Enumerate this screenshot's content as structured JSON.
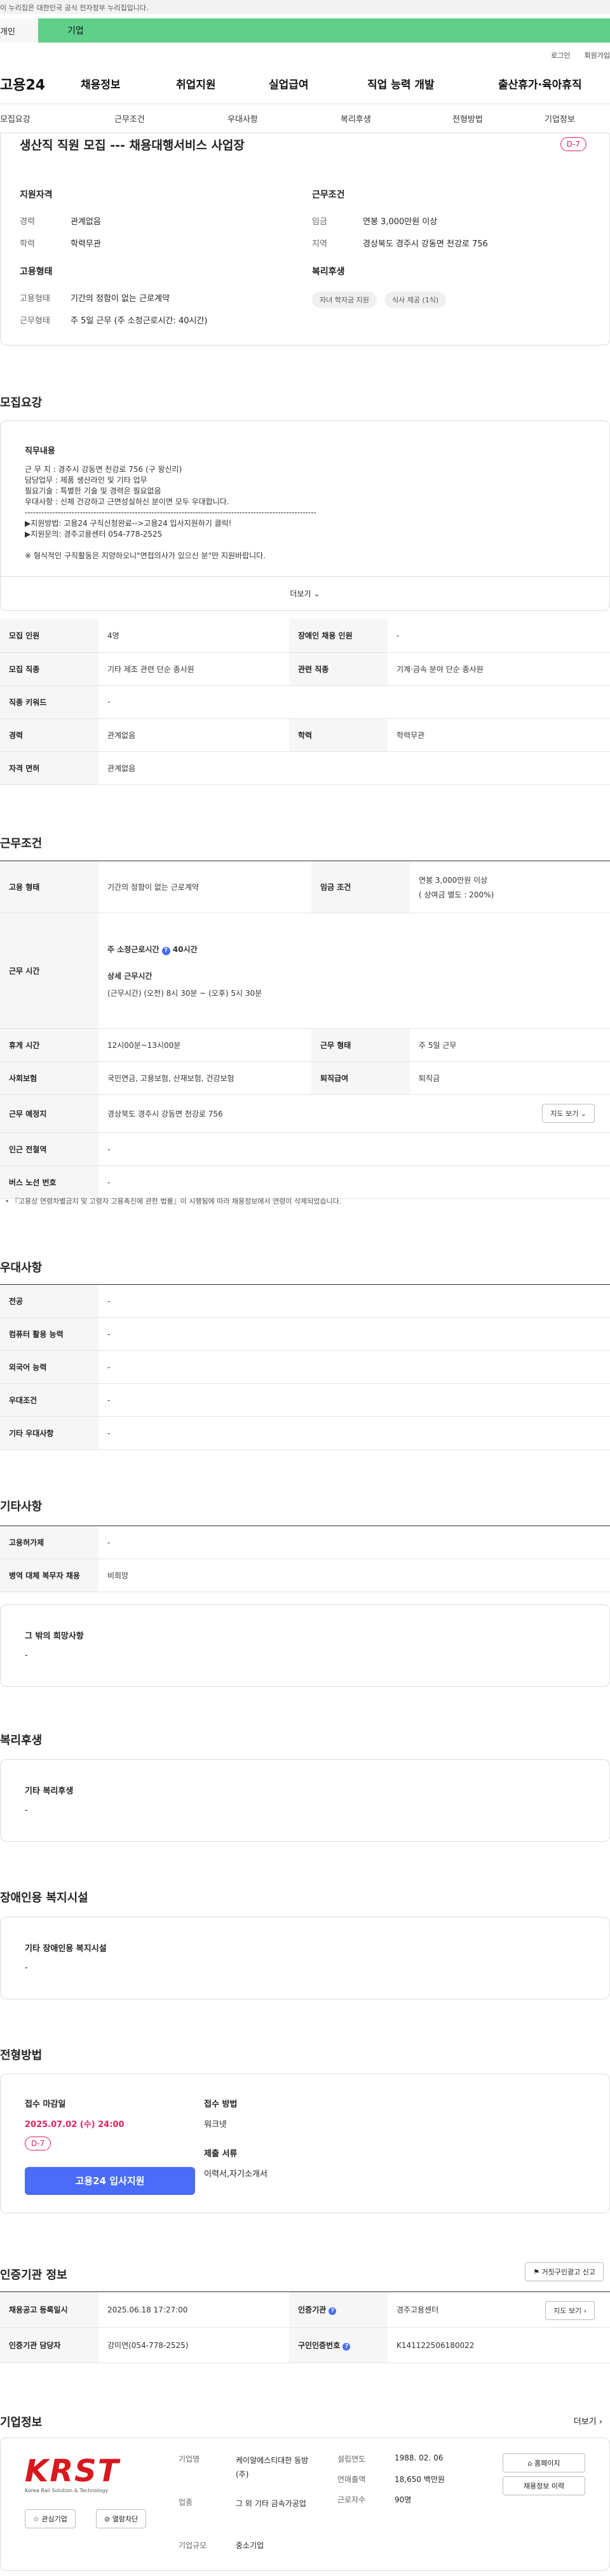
{
  "gov_banner": "이 누리집은 대한민국 공식 전자정부 누리집입니다.",
  "top_left": "개인",
  "top_tab": "기업",
  "util": [
    "로그인",
    "회원가입"
  ],
  "logo": "고용24",
  "gnb": [
    "채용정보",
    "취업지원",
    "실업급여",
    "직업 능력 개발",
    "출산휴가·육아휴직"
  ],
  "tabs": [
    "모집요강",
    "근무조건",
    "우대사항",
    "복리후생",
    "전형방법",
    "기업정보"
  ],
  "job": {
    "title": "생산직 직원 모집 --- 채용대행서비스 사업장",
    "dday": "D-7",
    "qual_title": "지원자격",
    "career_k": "경력",
    "career_v": "관계없음",
    "edu_k": "학력",
    "edu_v": "학력무관",
    "cond_title": "근무조건",
    "wage_k": "임금",
    "wage_v": "연봉 3,000만원 이상",
    "loc_k": "지역",
    "loc_v": "경상북도 경주시 강동면 천강로 756",
    "emp_title": "고용형태",
    "type_k": "고용형태",
    "type_v": "기간의 정함이 없는 근로계약",
    "form_k": "근무형태",
    "form_v": "주 5일 근무 (주 소정근로시간: 40시간)",
    "welfare_title": "복리후생",
    "welfare_chips": [
      "자녀 학자금 지원",
      "식사 제공 (1식)"
    ]
  },
  "recruit": {
    "title": "모집요강",
    "duty_title": "직무내용",
    "duty_lines": [
      "근  무  지 : 경주시 강동면 천강로 756 (구 왕신리)",
      "담당업무 : 제품 생산라인 및 기타 업무",
      "필요기술 : 특별한 기술 및 경력은 필요없음",
      "우대사항 : 신체 건강하고 근면성실하신 분이면 모두 우대합니다.",
      "----------------------------------------------------------------------------------------------------------",
      "▶지원방법: 고용24 구직신청완료-->고용24 입사지원하기 클릭!",
      "▶지원문의: 경주고용센터 054-778-2525",
      "",
      "※ 형식적인 구직활동은 지양하오니\"면접의사가 있으신 분\"만 지원바랍니다."
    ],
    "more": "더보기",
    "rows": [
      [
        "모집 인원",
        "4명",
        "장애인 채용 인원",
        "-"
      ],
      [
        "모집 직종",
        "기타 제조 관련 단순 종사원",
        "관련 직종",
        "기계·금속 분야 단순 종사원"
      ],
      [
        "직종 키워드",
        "-",
        "",
        ""
      ],
      [
        "경력",
        "관계없음",
        "학력",
        "학력무관"
      ],
      [
        "자격 면허",
        "관계없음",
        "",
        ""
      ]
    ]
  },
  "work": {
    "title": "근무조건",
    "emp_k": "고용 형태",
    "emp_v": "기간의 정함이 없는 근로계약",
    "wage_k": "임금 조건",
    "wage_v1": "연봉 3,000만원 이상",
    "wage_v2": "( 상여금 별도 : 200%)",
    "time_k": "근무 시간",
    "time_v1": "주 소정근로시간",
    "time_v1b": "40시간",
    "time_v2": "상세 근무시간",
    "time_v3": "(근무시간) (오전) 8시 30분 ~ (오후) 5시 30분",
    "rest_k": "휴게 시간",
    "rest_v": "12시00분~13시00분",
    "form_k": "근무 형태",
    "form_v": "주 5일 근무",
    "ins_k": "사회보험",
    "ins_v": "국민연금, 고용보험, 산재보험, 건강보험",
    "sev_k": "퇴직급여",
    "sev_v": "퇴직금",
    "place_k": "근무 예정지",
    "place_v": "경상북도 경주시 강동면 천강로 756",
    "map": "지도 보기",
    "sub_k": "인근 전철역",
    "sub_v": "-",
    "bus_k": "버스 노선 번호",
    "bus_v": "-",
    "note": "• 『고용상 연령차별금지 및 고령자 고용촉진에 관한 법률』이 시행됨에 따라 채용정보에서 연령이 삭제되었습니다."
  },
  "pref": {
    "title": "우대사항",
    "rows": [
      [
        "전공",
        "-"
      ],
      [
        "컴퓨터 활용 능력",
        "-"
      ],
      [
        "외국어 능력",
        "-"
      ],
      [
        "우대조건",
        "-"
      ],
      [
        "기타 우대사항",
        "-"
      ]
    ]
  },
  "etc": {
    "title": "기타사항",
    "rows": [
      [
        "고용허가제",
        "-"
      ],
      [
        "병역 대체 복무자 채용",
        "비희망"
      ]
    ],
    "other_title": "그 밖의 희망사항",
    "other_v": "-"
  },
  "welfare": {
    "title": "복리후생",
    "sub": "기타 복리후생",
    "v": "-"
  },
  "disab": {
    "title": "장애인용 복지시설",
    "sub": "기타 장애인용 복지시설",
    "v": "-"
  },
  "process": {
    "title": "전형방법",
    "deadline_k": "접수 마감일",
    "deadline_v": "2025.07.02 (수) 24:00",
    "dday": "D-7",
    "apply_btn": "고용24 입사지원",
    "method_k": "접수 방법",
    "method_v": "워크넷",
    "docs_k": "제출 서류",
    "docs_v": "이력서,자기소개서"
  },
  "cert": {
    "title": "인증기관 정보",
    "report": "거짓구인광고 신고",
    "reg_k": "채용공고 등록일시",
    "reg_v": "2025.06.18 17:27:00",
    "org_k": "인증기관",
    "org_v": "경주고용센터",
    "map": "지도 보기",
    "mgr_k": "인증기관 담당자",
    "mgr_v": "강미연(054-778-2525)",
    "no_k": "구인인증번호",
    "no_v": "K141122506180022"
  },
  "company": {
    "title": "기업정보",
    "more": "더보기",
    "logo_text": "KRST",
    "logo_sub": "Korea Rail Solution & Technology",
    "fav": "관심기업",
    "block": "열람차단",
    "name_k": "기업명",
    "name_v": "케이알에스티대한 동방(주)",
    "ind_k": "업종",
    "ind_v": "그 외 기타 금속가공업",
    "size_k": "기업규모",
    "size_v": "중소기업",
    "est_k": "설립연도",
    "est_v": "1988. 02. 06",
    "sales_k": "연매출액",
    "sales_v": "18,650 백만원",
    "emp_k": "근로자수",
    "emp_v": "90명",
    "home": "홈페이지",
    "jobs": "채용정보 이력"
  },
  "colors": {
    "green": "#5fcf8a",
    "accent": "#e0245e",
    "primary": "#4a6cf7",
    "red_logo": "#d7191f"
  }
}
